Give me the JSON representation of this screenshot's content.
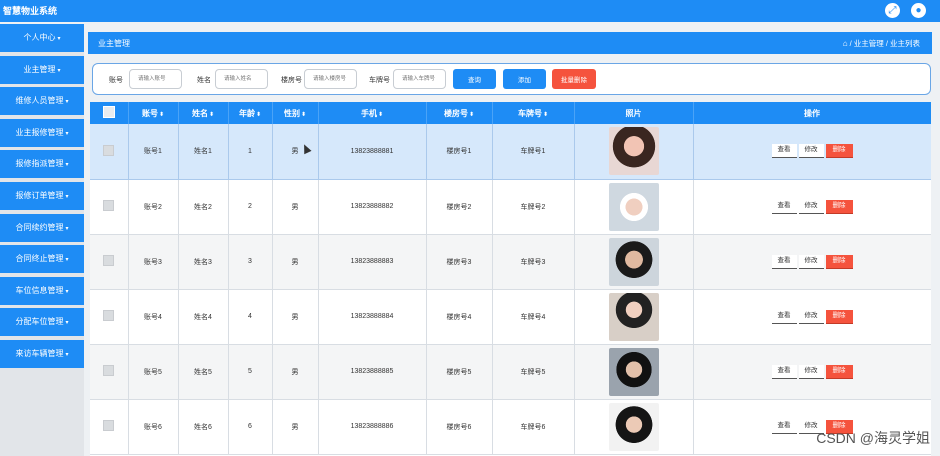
{
  "app": {
    "title": "智慧物业系统"
  },
  "topbar": {
    "fullscreen_icon": "fullscreen-icon",
    "user_icon": "user-icon"
  },
  "sidebar": {
    "items": [
      {
        "label": "个人中心",
        "caret": true
      },
      {
        "label": "业主管理",
        "caret": true
      },
      {
        "label": "维修人员管理",
        "caret": true
      },
      {
        "label": "业主报修管理",
        "caret": true
      },
      {
        "label": "报修指派管理",
        "caret": true
      },
      {
        "label": "报修订单管理",
        "caret": true
      },
      {
        "label": "合同续约管理",
        "caret": true
      },
      {
        "label": "合同终止管理",
        "caret": true
      },
      {
        "label": "车位信息管理",
        "caret": true
      },
      {
        "label": "分配车位管理",
        "caret": true
      },
      {
        "label": "来访车辆管理",
        "caret": true
      }
    ]
  },
  "header": {
    "title": "业主管理",
    "breadcrumb": "/ 业主管理 / 业主列表"
  },
  "search": {
    "account_label": "账号",
    "account_placeholder": "请输入账号",
    "name_label": "姓名",
    "name_placeholder": "请输入姓名",
    "room_label": "楼房号",
    "room_placeholder": "请输入楼房号",
    "plate_label": "车牌号",
    "plate_placeholder": "请输入车牌号",
    "query_button": "查询",
    "add_button": "添加",
    "batch_delete_button": "批量删除"
  },
  "table": {
    "columns": [
      "账号",
      "姓名",
      "年龄",
      "性别",
      "手机",
      "楼房号",
      "车牌号",
      "照片",
      "操作"
    ],
    "sortable": [
      true,
      true,
      true,
      true,
      true,
      true,
      true,
      false,
      false
    ],
    "actions": {
      "view": "查看",
      "edit": "修改",
      "delete": "删除"
    },
    "rows": [
      {
        "account": "账号1",
        "name": "姓名1",
        "age": "1",
        "gender": "男",
        "phone": "13823888881",
        "room": "楼房号1",
        "plate": "车牌号1"
      },
      {
        "account": "账号2",
        "name": "姓名2",
        "age": "2",
        "gender": "男",
        "phone": "13823888882",
        "room": "楼房号2",
        "plate": "车牌号2"
      },
      {
        "account": "账号3",
        "name": "姓名3",
        "age": "3",
        "gender": "男",
        "phone": "13823888883",
        "room": "楼房号3",
        "plate": "车牌号3"
      },
      {
        "account": "账号4",
        "name": "姓名4",
        "age": "4",
        "gender": "男",
        "phone": "13823888884",
        "room": "楼房号4",
        "plate": "车牌号4"
      },
      {
        "account": "账号5",
        "name": "姓名5",
        "age": "5",
        "gender": "男",
        "phone": "13823888885",
        "room": "楼房号5",
        "plate": "车牌号5"
      },
      {
        "account": "账号6",
        "name": "姓名6",
        "age": "6",
        "gender": "男",
        "phone": "13823888886",
        "room": "楼房号6",
        "plate": "车牌号6"
      }
    ]
  },
  "colors": {
    "primary": "#1e8cf5",
    "danger": "#f5533d",
    "selected_row": "#d6e8fb"
  },
  "watermark": "CSDN @海灵学姐"
}
